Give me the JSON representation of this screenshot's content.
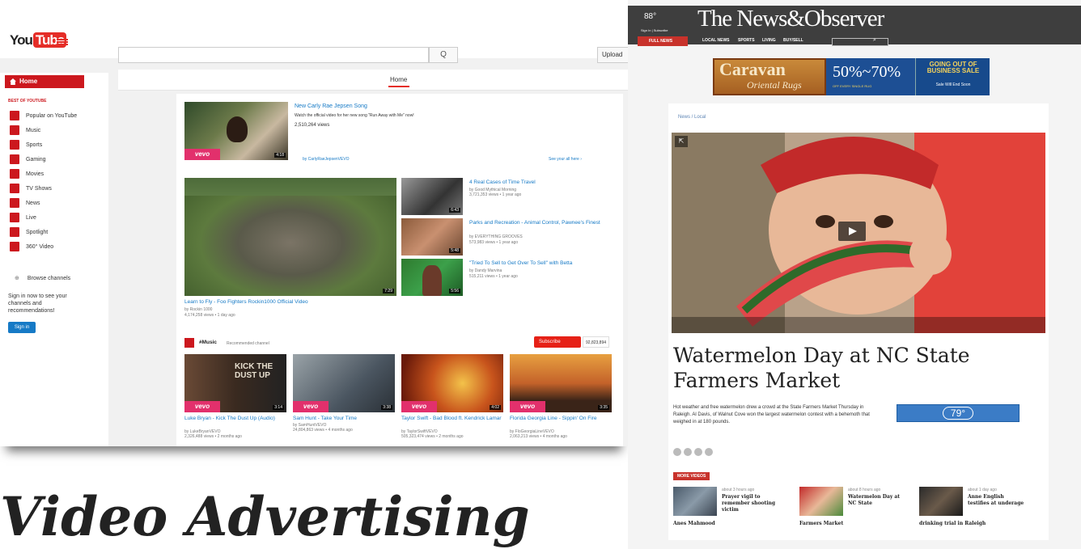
{
  "caption": "Video Advertising",
  "youtube": {
    "logo_you": "You",
    "logo_tube": "Tube",
    "search_button": "Q",
    "upload_label": "Upload",
    "tab_home": "Home",
    "sidebar": {
      "home": "Home",
      "section_caption": "BEST OF YOUTUBE",
      "items": [
        "Popular on YouTube",
        "Music",
        "Sports",
        "Gaming",
        "Movies",
        "TV Shows",
        "News",
        "Live",
        "Spotlight",
        "360° Video"
      ],
      "browse_channels": "Browse channels",
      "signin_text": "Sign in now to see your channels and recommendations!",
      "signin_button": "Sign in"
    },
    "featured": {
      "title": "New Carly Rae Jepsen Song",
      "desc": "Watch the official video for her new song \"Run Away with Me\" now!",
      "views": "2,510,264 views",
      "channel": "by CarlyRaeJepsenVEVO",
      "see_all": "See your all here ›",
      "duration": "4:18"
    },
    "big_video": {
      "title": "Learn to Fly - Foo Fighters Rockin1000 Official Video",
      "channel": "by Rockin 1000",
      "meta": "4,174,258 views • 1 day ago",
      "duration": "7:29"
    },
    "side_videos": [
      {
        "title": "4 Real Cases of Time Travel",
        "channel": "by Good Mythical Morning",
        "meta": "3,721,353 views • 1 year ago",
        "duration": "6:43"
      },
      {
        "title": "Parks and Recreation - Animal Control, Pawnee's Finest",
        "channel": "by EVERYTHING GROOVES",
        "meta": "573,983 views • 1 year ago",
        "duration": "5:48"
      },
      {
        "title": "\"Tried To Sell to Get Over To Sell\" with Betta",
        "channel": "by Dandy Marvina",
        "meta": "515,211 views • 1 year ago",
        "duration": "5:56"
      }
    ],
    "music": {
      "label": "#Music",
      "sub": "Recommended channel",
      "subscribe": "Subscribe",
      "count": "92,823,894",
      "videos": [
        {
          "title": "Luke Bryan - Kick The Dust Up (Audio)",
          "channel": "by LukeBryanVEVO",
          "meta": "2,326,488 views • 2 months ago",
          "duration": "3:14",
          "overlay": "KICK THE DUST UP"
        },
        {
          "title": "Sam Hunt - Take Your Time",
          "channel": "by SamHuntVEVO",
          "meta": "24,804,863 views • 4 months ago",
          "duration": "3:38",
          "overlay": ""
        },
        {
          "title": "Taylor Swift - Bad Blood ft. Kendrick Lamar",
          "channel": "by TaylorSwiftVEVO",
          "meta": "505,323,474 views • 2 months ago",
          "duration": "4:02",
          "overlay": ""
        },
        {
          "title": "Florida Georgia Line - Sippin' On Fire",
          "channel": "by FloGeorgiaLineVEVO",
          "meta": "2,063,213 views • 4 months ago",
          "duration": "3:35",
          "overlay": ""
        }
      ]
    }
  },
  "news": {
    "masthead": "The News&Observer",
    "weather": "88°",
    "signin": "Sign In | Subscribe",
    "full_news": "FULL NEWS",
    "nav": [
      "LOCAL NEWS",
      "SPORTS",
      "LIVING",
      "BUY/SELL"
    ],
    "ad": {
      "caravan": "Caravan",
      "oriental": "Oriental Rugs",
      "percent": "50%~70%",
      "percent_sub": "OFF EVERY SINGLE RUG",
      "going_out": "GOING OUT OF BUSINESS SALE",
      "sale": "Sale Will End Soon"
    },
    "breadcrumb": "News / Local",
    "headline": "Watermelon Day at NC State Farmers Market",
    "summary": "Hot weather and free watermelon drew a crowd at the State Farmers Market Thursday in Raleigh. Al Davis, of Walnut Cove won the largest watermelon contest with a behemoth that weighed in at 180 pounds.",
    "weather_ad_temp": "79°",
    "more_videos": "MORE VIDEOS",
    "related": [
      {
        "time": "about 3 hours ago",
        "title": "Prayer vigil to remember shooting victim",
        "sub": "Anes Mahmood"
      },
      {
        "time": "about 8 hours ago",
        "title": "Watermelon Day at NC State",
        "sub": "Farmers Market"
      },
      {
        "time": "about 1 day ago",
        "title": "Anne English testifies at underage",
        "sub": "drinking trial in Raleigh"
      }
    ]
  },
  "colors": {
    "youtube_red": "#cc181e",
    "youtube_link": "#167ac6",
    "vevo_pink": "#e2306c",
    "news_header": "#3e3e3e",
    "news_red": "#c8322b"
  }
}
